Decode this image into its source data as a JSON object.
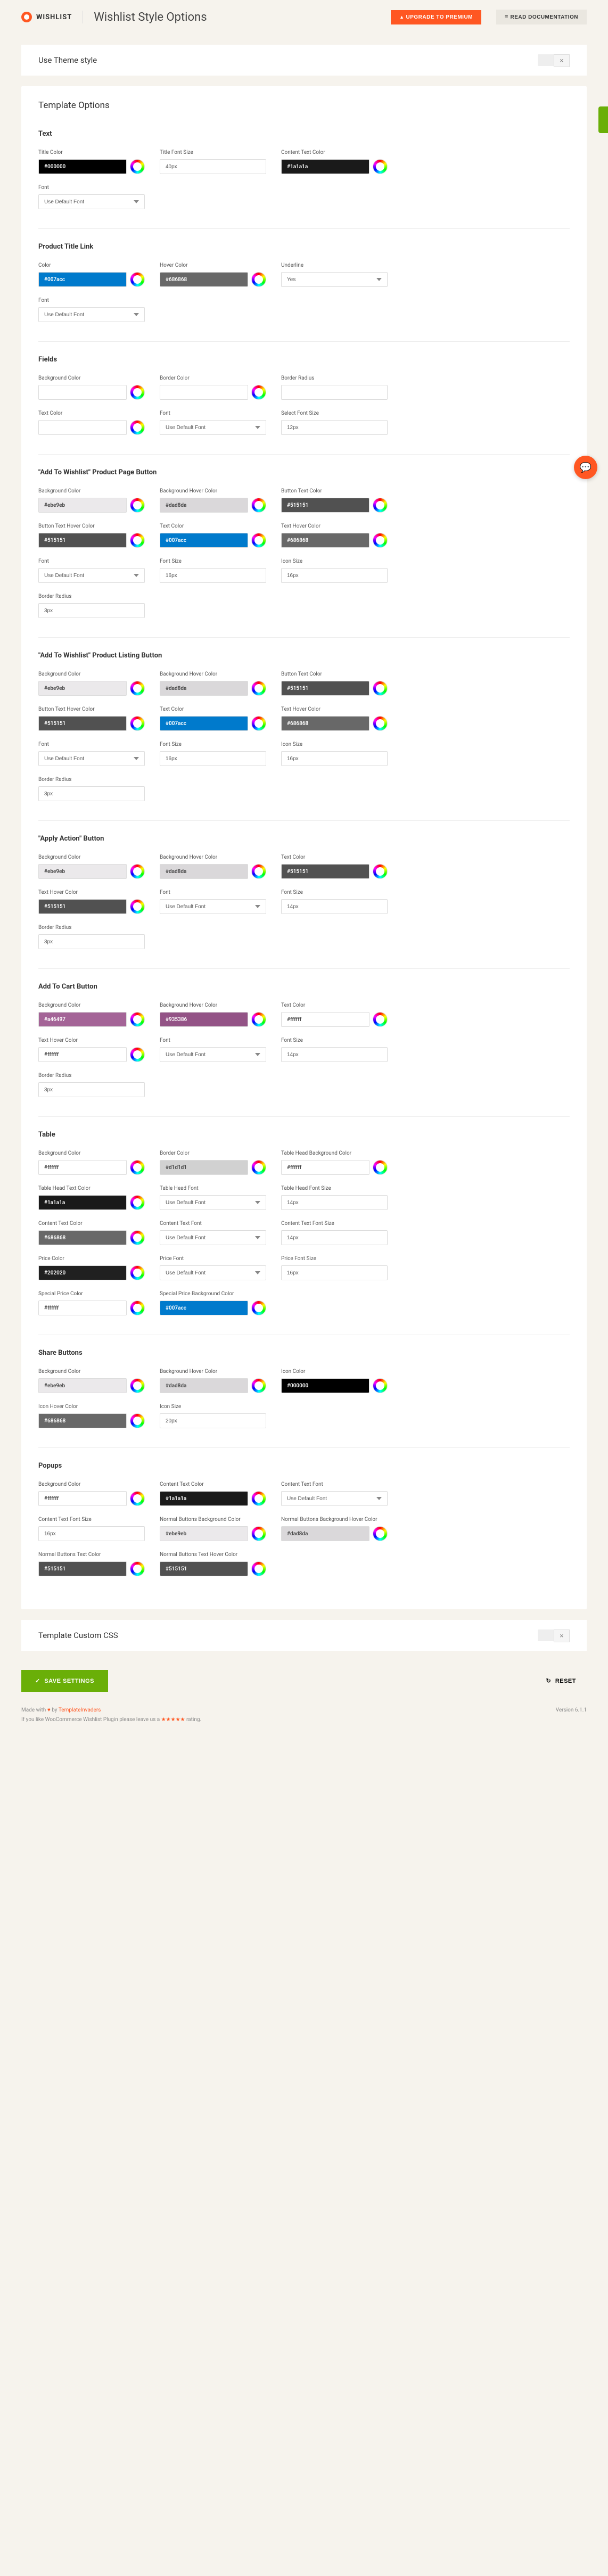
{
  "header": {
    "brand": "WISHLIST",
    "title": "Wishlist Style Options",
    "premium": "UPGRADE TO PREMIUM",
    "docs": "READ DOCUMENTATION"
  },
  "panels": {
    "theme": "Use Theme style",
    "template": "Template Options",
    "css": "Template Custom CSS"
  },
  "footer": {
    "save": "SAVE SETTINGS",
    "reset": "RESET",
    "made": "Made with",
    "by": "by",
    "author": "TemplateInvaders",
    "rate": "If you like WooCommerce Wishlist Plugin please leave us a",
    "rating_suffix": "rating.",
    "version": "Version 6.1.1"
  },
  "common": {
    "useDefaultFont": "Use Default Font",
    "yes": "Yes"
  },
  "sections": [
    {
      "title": "Text",
      "rows": [
        [
          {
            "t": "c",
            "l": "Title Color",
            "v": "#000000",
            "dark": true
          },
          {
            "t": "i",
            "l": "Title Font Size",
            "v": "40px"
          },
          {
            "t": "c",
            "l": "Content Text Color",
            "v": "#1a1a1a",
            "dark": true
          }
        ],
        [
          {
            "t": "s",
            "l": "Font",
            "v": "Use Default Font"
          }
        ]
      ]
    },
    {
      "title": "Product Title Link",
      "rows": [
        [
          {
            "t": "c",
            "l": "Color",
            "v": "#007acc",
            "bg": "#007acc",
            "dark": true
          },
          {
            "t": "c",
            "l": "Hover Color",
            "v": "#686868",
            "bg": "#686868",
            "dark": true
          },
          {
            "t": "s",
            "l": "Underline",
            "v": "Yes"
          }
        ],
        [
          {
            "t": "s",
            "l": "Font",
            "v": "Use Default Font"
          }
        ]
      ]
    },
    {
      "title": "Fields",
      "rows": [
        [
          {
            "t": "c",
            "l": "Background Color",
            "v": "",
            "bg": "#fff"
          },
          {
            "t": "c",
            "l": "Border Color",
            "v": "",
            "bg": "#fff"
          },
          {
            "t": "i",
            "l": "Border Radius",
            "v": ""
          }
        ],
        [
          {
            "t": "c",
            "l": "Text Color",
            "v": "",
            "bg": "#fff"
          },
          {
            "t": "s",
            "l": "Font",
            "v": "Use Default Font"
          },
          {
            "t": "i",
            "l": "Select Font Size",
            "v": "12px"
          }
        ]
      ]
    },
    {
      "title": "\"Add To Wishlist\" Product Page Button",
      "rows": [
        [
          {
            "t": "c",
            "l": "Background Color",
            "v": "#ebe9eb",
            "bg": "#ebe9eb"
          },
          {
            "t": "c",
            "l": "Background Hover Color",
            "v": "#dad8da",
            "bg": "#dad8da"
          },
          {
            "t": "c",
            "l": "Button Text Color",
            "v": "#515151",
            "bg": "#515151",
            "dark": true
          }
        ],
        [
          {
            "t": "c",
            "l": "Button Text Hover Color",
            "v": "#515151",
            "bg": "#515151",
            "dark": true
          },
          {
            "t": "c",
            "l": "Text Color",
            "v": "#007acc",
            "bg": "#007acc",
            "dark": true
          },
          {
            "t": "c",
            "l": "Text Hover Color",
            "v": "#686868",
            "bg": "#686868",
            "dark": true
          }
        ],
        [
          {
            "t": "s",
            "l": "Font",
            "v": "Use Default Font"
          },
          {
            "t": "i",
            "l": "Font Size",
            "v": "16px"
          },
          {
            "t": "i",
            "l": "Icon Size",
            "v": "16px"
          }
        ],
        [
          {
            "t": "i",
            "l": "Border Radius",
            "v": "3px"
          }
        ]
      ]
    },
    {
      "title": "\"Add To Wishlist\" Product Listing Button",
      "rows": [
        [
          {
            "t": "c",
            "l": "Background Color",
            "v": "#ebe9eb",
            "bg": "#ebe9eb"
          },
          {
            "t": "c",
            "l": "Background Hover Color",
            "v": "#dad8da",
            "bg": "#dad8da"
          },
          {
            "t": "c",
            "l": "Button Text Color",
            "v": "#515151",
            "bg": "#515151",
            "dark": true
          }
        ],
        [
          {
            "t": "c",
            "l": "Button Text Hover Color",
            "v": "#515151",
            "bg": "#515151",
            "dark": true
          },
          {
            "t": "c",
            "l": "Text Color",
            "v": "#007acc",
            "bg": "#007acc",
            "dark": true
          },
          {
            "t": "c",
            "l": "Text Hover Color",
            "v": "#686868",
            "bg": "#686868",
            "dark": true
          }
        ],
        [
          {
            "t": "s",
            "l": "Font",
            "v": "Use Default Font"
          },
          {
            "t": "i",
            "l": "Font Size",
            "v": "16px"
          },
          {
            "t": "i",
            "l": "Icon Size",
            "v": "16px"
          }
        ],
        [
          {
            "t": "i",
            "l": "Border Radius",
            "v": "3px"
          }
        ]
      ]
    },
    {
      "title": "\"Apply Action\" Button",
      "rows": [
        [
          {
            "t": "c",
            "l": "Background Color",
            "v": "#ebe9eb",
            "bg": "#ebe9eb"
          },
          {
            "t": "c",
            "l": "Background Hover Color",
            "v": "#dad8da",
            "bg": "#dad8da"
          },
          {
            "t": "c",
            "l": "Text Color",
            "v": "#515151",
            "bg": "#515151",
            "dark": true
          }
        ],
        [
          {
            "t": "c",
            "l": "Text Hover Color",
            "v": "#515151",
            "bg": "#515151",
            "dark": true
          },
          {
            "t": "s",
            "l": "Font",
            "v": "Use Default Font"
          },
          {
            "t": "i",
            "l": "Font Size",
            "v": "14px"
          }
        ],
        [
          {
            "t": "i",
            "l": "Border Radius",
            "v": "3px"
          }
        ]
      ]
    },
    {
      "title": "Add To Cart Button",
      "rows": [
        [
          {
            "t": "c",
            "l": "Background Color",
            "v": "#a46497",
            "bg": "#a46497",
            "dark": true
          },
          {
            "t": "c",
            "l": "Background Hover Color",
            "v": "#935386",
            "bg": "#935386",
            "dark": true
          },
          {
            "t": "c",
            "l": "Text Color",
            "v": "#ffffff",
            "bg": "#fff"
          }
        ],
        [
          {
            "t": "c",
            "l": "Text Hover Color",
            "v": "#ffffff",
            "bg": "#fff"
          },
          {
            "t": "s",
            "l": "Font",
            "v": "Use Default Font"
          },
          {
            "t": "i",
            "l": "Font Size",
            "v": "14px"
          }
        ],
        [
          {
            "t": "i",
            "l": "Border Radius",
            "v": "3px"
          }
        ]
      ]
    },
    {
      "title": "Table",
      "rows": [
        [
          {
            "t": "c",
            "l": "Background Color",
            "v": "#ffffff",
            "bg": "#fff"
          },
          {
            "t": "c",
            "l": "Border Color",
            "v": "#d1d1d1",
            "bg": "#d1d1d1"
          },
          {
            "t": "c",
            "l": "Table Head Background Color",
            "v": "#ffffff",
            "bg": "#fff"
          }
        ],
        [
          {
            "t": "c",
            "l": "Table Head Text Color",
            "v": "#1a1a1a",
            "bg": "#1a1a1a",
            "dark": true
          },
          {
            "t": "s",
            "l": "Table Head Font",
            "v": "Use Default Font"
          },
          {
            "t": "i",
            "l": "Table Head Font Size",
            "v": "14px"
          }
        ],
        [
          {
            "t": "c",
            "l": "Content Text Color",
            "v": "#686868",
            "bg": "#686868",
            "dark": true
          },
          {
            "t": "s",
            "l": "Content Text Font",
            "v": "Use Default Font"
          },
          {
            "t": "i",
            "l": "Content Text Font Size",
            "v": "14px"
          }
        ],
        [
          {
            "t": "c",
            "l": "Price Color",
            "v": "#202020",
            "bg": "#202020",
            "dark": true
          },
          {
            "t": "s",
            "l": "Price Font",
            "v": "Use Default Font"
          },
          {
            "t": "i",
            "l": "Price Font Size",
            "v": "16px"
          }
        ],
        [
          {
            "t": "c",
            "l": "Special Price Color",
            "v": "#ffffff",
            "bg": "#fff"
          },
          {
            "t": "c",
            "l": "Special Price Background Color",
            "v": "#007acc",
            "bg": "#007acc",
            "dark": true
          }
        ]
      ]
    },
    {
      "title": "Share Buttons",
      "rows": [
        [
          {
            "t": "c",
            "l": "Background Color",
            "v": "#ebe9eb",
            "bg": "#ebe9eb"
          },
          {
            "t": "c",
            "l": "Background Hover Color",
            "v": "#dad8da",
            "bg": "#dad8da"
          },
          {
            "t": "c",
            "l": "Icon Color",
            "v": "#000000",
            "bg": "#000",
            "dark": true
          }
        ],
        [
          {
            "t": "c",
            "l": "Icon Hover Color",
            "v": "#686868",
            "bg": "#686868",
            "dark": true
          },
          {
            "t": "i",
            "l": "Icon Size",
            "v": "20px"
          }
        ]
      ]
    },
    {
      "title": "Popups",
      "rows": [
        [
          {
            "t": "c",
            "l": "Background Color",
            "v": "#ffffff",
            "bg": "#fff"
          },
          {
            "t": "c",
            "l": "Content Text Color",
            "v": "#1a1a1a",
            "bg": "#1a1a1a",
            "dark": true
          },
          {
            "t": "s",
            "l": "Content Text Font",
            "v": "Use Default Font"
          }
        ],
        [
          {
            "t": "i",
            "l": "Content Text Font Size",
            "v": "16px"
          },
          {
            "t": "c",
            "l": "Normal Buttons Background Color",
            "v": "#ebe9eb",
            "bg": "#ebe9eb"
          },
          {
            "t": "c",
            "l": "Normal Buttons Background Hover Color",
            "v": "#dad8da",
            "bg": "#dad8da"
          }
        ],
        [
          {
            "t": "c",
            "l": "Normal Buttons Text Color",
            "v": "#515151",
            "bg": "#515151",
            "dark": true
          },
          {
            "t": "c",
            "l": "Normal Buttons Text Hover Color",
            "v": "#515151",
            "bg": "#515151",
            "dark": true
          }
        ]
      ]
    }
  ]
}
